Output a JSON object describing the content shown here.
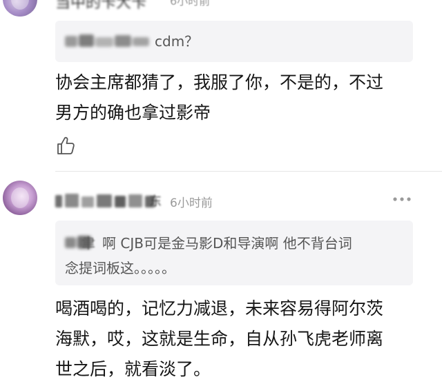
{
  "comment_top": {
    "username": "当中的卡大卡",
    "time": "6小时前",
    "quote": {
      "author": "██████",
      "text": "cdm？"
    },
    "body_lines": [
      "协会主席都猜了，我服了你，不是的，不过",
      "男方的确也拿过影帝"
    ],
    "like_icon": "thumbs-up-icon"
  },
  "comment_second": {
    "username_tail": "东",
    "time": "6小时前",
    "more_icon": "more-dots-icon",
    "quote": {
      "author_tail": "聿",
      "lines": [
        "啊 CJB可是金马影D和导演啊 他不背台词",
        "念提词板这。。。。。"
      ]
    },
    "body_lines": [
      "喝酒喝的，记忆力减退，未来容易得阿尔茨",
      "海默，哎，这就是生命，自从孙飞虎老师离",
      "世之后，就看淡了。"
    ]
  },
  "colors": {
    "quote_bg": "#f4f4f6",
    "meta_text": "#9a9a9a",
    "body_text": "#161616"
  }
}
